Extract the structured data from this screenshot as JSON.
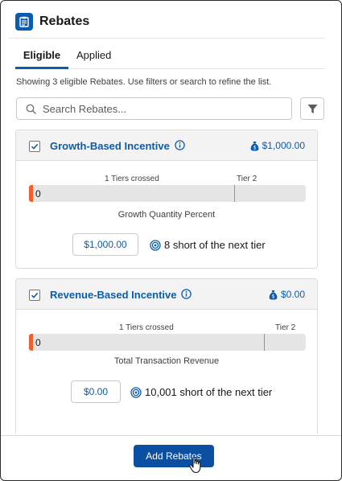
{
  "header": {
    "title": "Rebates",
    "icon": "rebates-list-icon"
  },
  "tabs": [
    {
      "label": "Eligible",
      "active": true
    },
    {
      "label": "Applied",
      "active": false
    }
  ],
  "helper_text": "Showing 3 eligible Rebates. Use filters or search to refine the list.",
  "search": {
    "placeholder": "Search Rebates...",
    "value": ""
  },
  "cards": [
    {
      "title": "Growth-Based Incentive",
      "amount": "$1,000.00",
      "checked": true,
      "tiers_crossed": "1 Tiers crossed",
      "tier_label": "Tier 2",
      "progress_value": "0",
      "metric": "Growth Quantity Percent",
      "current_amount": "$1,000.00",
      "short_text": "8 short of the next tier"
    },
    {
      "title": "Revenue-Based Incentive",
      "amount": "$0.00",
      "checked": true,
      "tiers_crossed": "1 Tiers crossed",
      "tier_label": "Tier 2",
      "progress_value": "0",
      "metric": "Total Transaction Revenue",
      "current_amount": "$0.00",
      "short_text": "10,001 short of the next tier"
    }
  ],
  "footer": {
    "add_label": "Add Rebates"
  },
  "colors": {
    "brand": "#0b5cab",
    "button": "#0b4fa0",
    "progress_start": "#f0602c"
  }
}
